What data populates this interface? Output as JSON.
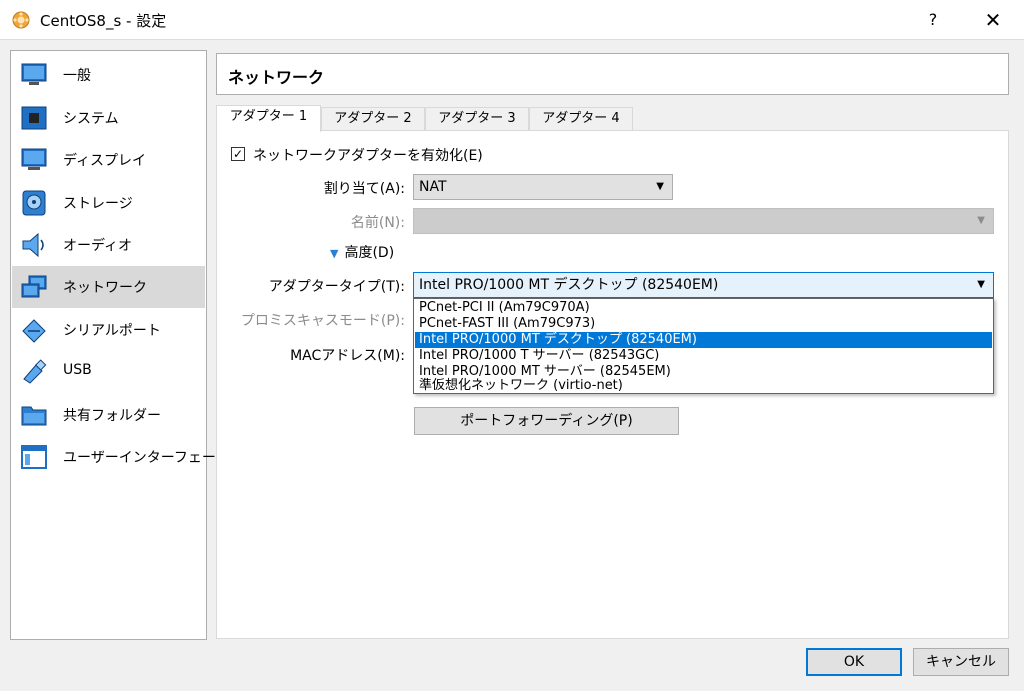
{
  "window": {
    "title": "CentOS8_s - 設定",
    "help_label": "?",
    "close_label": "✕",
    "app_icon": "virtualbox-icon"
  },
  "sidebar": {
    "items": [
      {
        "label": "一般",
        "icon": "monitor-icon"
      },
      {
        "label": "システム",
        "icon": "motherboard-icon"
      },
      {
        "label": "ディスプレイ",
        "icon": "display-icon"
      },
      {
        "label": "ストレージ",
        "icon": "disk-icon"
      },
      {
        "label": "オーディオ",
        "icon": "speaker-icon"
      },
      {
        "label": "ネットワーク",
        "icon": "network-icon",
        "selected": true
      },
      {
        "label": "シリアルポート",
        "icon": "serial-port-icon"
      },
      {
        "label": "USB",
        "icon": "usb-icon"
      },
      {
        "label": "共有フォルダー",
        "icon": "folder-icon"
      },
      {
        "label": "ユーザーインターフェース",
        "icon": "user-interface-icon"
      }
    ]
  },
  "page": {
    "title": "ネットワーク"
  },
  "tabs": [
    {
      "label": "アダプター 1",
      "active": true
    },
    {
      "label": "アダプター 2"
    },
    {
      "label": "アダプター 3"
    },
    {
      "label": "アダプター 4"
    }
  ],
  "form": {
    "enable_adapter": {
      "label": "ネットワークアダプターを有効化(E)",
      "checked": true,
      "check_mark": "✓"
    },
    "attached_to": {
      "label": "割り当て(A):",
      "value": "NAT"
    },
    "name": {
      "label": "名前(N):",
      "value": ""
    },
    "advanced": {
      "label": "高度(D)",
      "arrow": "▼"
    },
    "adapter_type": {
      "label": "アダプタータイプ(T):",
      "value": "Intel PRO/1000 MT デスクトップ (82540EM)",
      "options": [
        "PCnet-PCI II (Am79C970A)",
        "PCnet-FAST III (Am79C973)",
        "Intel PRO/1000 MT デスクトップ (82540EM)",
        "Intel PRO/1000 T サーバー (82543GC)",
        "Intel PRO/1000 MT サーバー (82545EM)",
        "準仮想化ネットワーク (virtio-net)"
      ],
      "selected_index": 2
    },
    "promiscuous_mode": {
      "label": "プロミスキャスモード(P):"
    },
    "mac_address": {
      "label": "MACアドレス(M):"
    },
    "port_forwarding": {
      "label": "ポートフォワーディング(P)"
    }
  },
  "footer": {
    "ok_label": "OK",
    "cancel_label": "キャンセル"
  },
  "colors": {
    "accent": "#0078d7",
    "selection_bg": "#d9d9d9",
    "disabled_text": "#8c8c8c"
  }
}
